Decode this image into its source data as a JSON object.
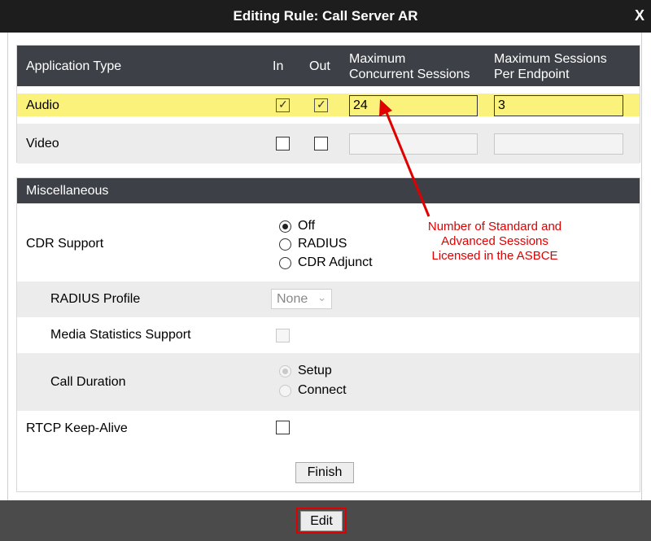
{
  "dialog": {
    "title": "Editing Rule: Call Server AR",
    "close_label": "X"
  },
  "applications": {
    "headers": {
      "type": "Application Type",
      "in": "In",
      "out": "Out",
      "max_concurrent_1": "Maximum",
      "max_concurrent_2": "Concurrent Sessions",
      "max_per_endpoint_1": "Maximum Sessions",
      "max_per_endpoint_2": "Per Endpoint"
    },
    "rows": [
      {
        "name": "Audio",
        "in": true,
        "out": true,
        "max_concurrent": "24",
        "max_per_endpoint": "3"
      },
      {
        "name": "Video",
        "in": false,
        "out": false,
        "max_concurrent": "",
        "max_per_endpoint": ""
      }
    ]
  },
  "misc": {
    "header": "Miscellaneous",
    "cdr_support": {
      "label": "CDR Support",
      "options": [
        "Off",
        "RADIUS",
        "CDR Adjunct"
      ],
      "selected": "Off"
    },
    "radius_profile": {
      "label": "RADIUS Profile",
      "value": "None"
    },
    "media_stats": {
      "label": "Media Statistics Support",
      "checked": false
    },
    "call_duration": {
      "label": "Call Duration",
      "options": [
        "Setup",
        "Connect"
      ],
      "selected": "Setup"
    },
    "rtcp_keepalive": {
      "label": "RTCP Keep-Alive",
      "checked": false
    }
  },
  "buttons": {
    "finish": "Finish",
    "edit": "Edit"
  },
  "annotation": {
    "line1": "Number of Standard and",
    "line2": "Advanced Sessions",
    "line3": "Licensed in the ASBCE",
    "color": "#e00000"
  },
  "colors": {
    "highlight": "#fbf27c",
    "header_bg": "#3d4147",
    "title_bg": "#1d1d1d"
  }
}
